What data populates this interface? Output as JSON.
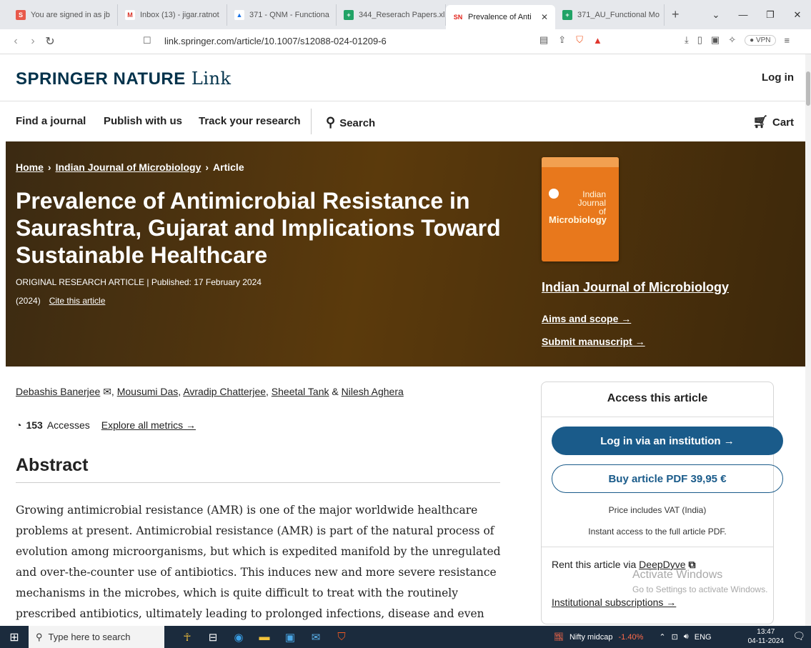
{
  "browser": {
    "tabs": [
      {
        "title": "You are signed in as jb",
        "fav_color": "#e8594b",
        "fav_letter": "S"
      },
      {
        "title": "Inbox (13) - jigar.ratnot",
        "fav_color": "#ffffff",
        "fav_letter": "M"
      },
      {
        "title": "371 - QNM - Functiona",
        "fav_color": "#ffffff",
        "fav_letter": "▲"
      },
      {
        "title": "344_Reserach Papers.xl",
        "fav_color": "#21a366",
        "fav_letter": "+"
      },
      {
        "title": "Prevalence of Anti",
        "fav_color": "#ffffff",
        "fav_letter": "SN"
      },
      {
        "title": "371_AU_Functional Mo",
        "fav_color": "#21a366",
        "fav_letter": "+"
      }
    ],
    "url": "link.springer.com/article/10.1007/s12088-024-01209-6",
    "vpn_label": "VPN"
  },
  "site": {
    "logo_bold": "SPRINGER NATURE",
    "logo_light": "Link",
    "login": "Log in",
    "nav": [
      "Find a journal",
      "Publish with us",
      "Track your research"
    ],
    "search": "Search",
    "cart": "Cart"
  },
  "hero": {
    "crumbs": [
      "Home",
      "Indian Journal of Microbiology",
      "Article"
    ],
    "title": "Prevalence of Antimicrobial Resistance in Saurashtra, Gujarat and Implications Toward Sustainable Healthcare",
    "meta_line": "ORIGINAL RESEARCH ARTICLE | Published: 17 February 2024",
    "year": "(2024)",
    "cite": "Cite this article",
    "cover_title_1": "Indian",
    "cover_title_2": "Journal",
    "cover_title_3": "of",
    "cover_title_4": "Microbiology",
    "journal_name": "Indian Journal of Microbiology",
    "aims": "Aims and scope →",
    "submit": "Submit manuscript →"
  },
  "article": {
    "authors": [
      "Debashis Banerjee",
      "Mousumi Das",
      "Avradip Chatterjee",
      "Sheetal Tank",
      "Nilesh Aghera"
    ],
    "accesses_count": "153",
    "accesses_label": "Accesses",
    "metrics_link": "Explore all metrics →",
    "abstract_heading": "Abstract",
    "abstract_text": "Growing antimicrobial resistance (AMR) is one of the major worldwide healthcare problems at present. Antimicrobial resistance (AMR) is part of the natural process of evolution among microorganisms, but which is expedited manifold by the unregulated and over-the-counter use of antibiotics. This induces new and more severe resistance mechanisms in the microbes, which is quite difficult to treat with the routinely prescribed antibiotics, ultimately leading to prolonged infections, disease and even death"
  },
  "access": {
    "title": "Access this article",
    "institution_btn": "Log in via an institution →",
    "buy_btn": "Buy article PDF 39,95 €",
    "vat_note": "Price includes VAT (India)",
    "instant_note": "Instant access to the full article PDF.",
    "rent_prefix": "Rent this article via",
    "rent_link": "DeepDyve",
    "inst_subs": "Institutional subscriptions →"
  },
  "watermark": {
    "line1": "Activate Windows",
    "line2": "Go to Settings to activate Windows."
  },
  "taskbar": {
    "search_placeholder": "Type here to search",
    "ticker_name": "Nifty midcap",
    "ticker_value": "-1.40%",
    "lang": "ENG",
    "time": "13:47",
    "date": "04-11-2024"
  }
}
